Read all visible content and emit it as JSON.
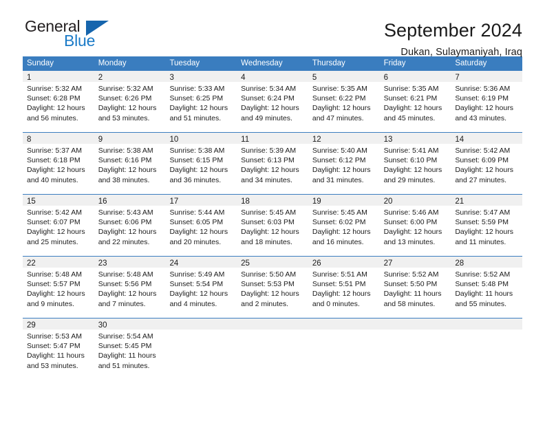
{
  "brand": {
    "line1": "General",
    "line2": "Blue",
    "flag_icon": "blue-triangle-flag",
    "colors": {
      "general": "#231f20",
      "blue": "#1a7ac7",
      "flag": "#1665ad"
    }
  },
  "header": {
    "title": "September 2024",
    "subtitle": "Dukan, Sulaymaniyah, Iraq"
  },
  "theme": {
    "header_blue": "#3a7dbf",
    "daynum_band": "#f0f0f0",
    "text": "#1a1a1a"
  },
  "weekdays": [
    "Sunday",
    "Monday",
    "Tuesday",
    "Wednesday",
    "Thursday",
    "Friday",
    "Saturday"
  ],
  "weeks": [
    [
      {
        "day": "1",
        "detail": "Sunrise: 5:32 AM\nSunset: 6:28 PM\nDaylight: 12 hours\nand 56 minutes."
      },
      {
        "day": "2",
        "detail": "Sunrise: 5:32 AM\nSunset: 6:26 PM\nDaylight: 12 hours\nand 53 minutes."
      },
      {
        "day": "3",
        "detail": "Sunrise: 5:33 AM\nSunset: 6:25 PM\nDaylight: 12 hours\nand 51 minutes."
      },
      {
        "day": "4",
        "detail": "Sunrise: 5:34 AM\nSunset: 6:24 PM\nDaylight: 12 hours\nand 49 minutes."
      },
      {
        "day": "5",
        "detail": "Sunrise: 5:35 AM\nSunset: 6:22 PM\nDaylight: 12 hours\nand 47 minutes."
      },
      {
        "day": "6",
        "detail": "Sunrise: 5:35 AM\nSunset: 6:21 PM\nDaylight: 12 hours\nand 45 minutes."
      },
      {
        "day": "7",
        "detail": "Sunrise: 5:36 AM\nSunset: 6:19 PM\nDaylight: 12 hours\nand 43 minutes."
      }
    ],
    [
      {
        "day": "8",
        "detail": "Sunrise: 5:37 AM\nSunset: 6:18 PM\nDaylight: 12 hours\nand 40 minutes."
      },
      {
        "day": "9",
        "detail": "Sunrise: 5:38 AM\nSunset: 6:16 PM\nDaylight: 12 hours\nand 38 minutes."
      },
      {
        "day": "10",
        "detail": "Sunrise: 5:38 AM\nSunset: 6:15 PM\nDaylight: 12 hours\nand 36 minutes."
      },
      {
        "day": "11",
        "detail": "Sunrise: 5:39 AM\nSunset: 6:13 PM\nDaylight: 12 hours\nand 34 minutes."
      },
      {
        "day": "12",
        "detail": "Sunrise: 5:40 AM\nSunset: 6:12 PM\nDaylight: 12 hours\nand 31 minutes."
      },
      {
        "day": "13",
        "detail": "Sunrise: 5:41 AM\nSunset: 6:10 PM\nDaylight: 12 hours\nand 29 minutes."
      },
      {
        "day": "14",
        "detail": "Sunrise: 5:42 AM\nSunset: 6:09 PM\nDaylight: 12 hours\nand 27 minutes."
      }
    ],
    [
      {
        "day": "15",
        "detail": "Sunrise: 5:42 AM\nSunset: 6:07 PM\nDaylight: 12 hours\nand 25 minutes."
      },
      {
        "day": "16",
        "detail": "Sunrise: 5:43 AM\nSunset: 6:06 PM\nDaylight: 12 hours\nand 22 minutes."
      },
      {
        "day": "17",
        "detail": "Sunrise: 5:44 AM\nSunset: 6:05 PM\nDaylight: 12 hours\nand 20 minutes."
      },
      {
        "day": "18",
        "detail": "Sunrise: 5:45 AM\nSunset: 6:03 PM\nDaylight: 12 hours\nand 18 minutes."
      },
      {
        "day": "19",
        "detail": "Sunrise: 5:45 AM\nSunset: 6:02 PM\nDaylight: 12 hours\nand 16 minutes."
      },
      {
        "day": "20",
        "detail": "Sunrise: 5:46 AM\nSunset: 6:00 PM\nDaylight: 12 hours\nand 13 minutes."
      },
      {
        "day": "21",
        "detail": "Sunrise: 5:47 AM\nSunset: 5:59 PM\nDaylight: 12 hours\nand 11 minutes."
      }
    ],
    [
      {
        "day": "22",
        "detail": "Sunrise: 5:48 AM\nSunset: 5:57 PM\nDaylight: 12 hours\nand 9 minutes."
      },
      {
        "day": "23",
        "detail": "Sunrise: 5:48 AM\nSunset: 5:56 PM\nDaylight: 12 hours\nand 7 minutes."
      },
      {
        "day": "24",
        "detail": "Sunrise: 5:49 AM\nSunset: 5:54 PM\nDaylight: 12 hours\nand 4 minutes."
      },
      {
        "day": "25",
        "detail": "Sunrise: 5:50 AM\nSunset: 5:53 PM\nDaylight: 12 hours\nand 2 minutes."
      },
      {
        "day": "26",
        "detail": "Sunrise: 5:51 AM\nSunset: 5:51 PM\nDaylight: 12 hours\nand 0 minutes."
      },
      {
        "day": "27",
        "detail": "Sunrise: 5:52 AM\nSunset: 5:50 PM\nDaylight: 11 hours\nand 58 minutes."
      },
      {
        "day": "28",
        "detail": "Sunrise: 5:52 AM\nSunset: 5:48 PM\nDaylight: 11 hours\nand 55 minutes."
      }
    ],
    [
      {
        "day": "29",
        "detail": "Sunrise: 5:53 AM\nSunset: 5:47 PM\nDaylight: 11 hours\nand 53 minutes."
      },
      {
        "day": "30",
        "detail": "Sunrise: 5:54 AM\nSunset: 5:45 PM\nDaylight: 11 hours\nand 51 minutes."
      },
      {
        "day": "",
        "detail": ""
      },
      {
        "day": "",
        "detail": ""
      },
      {
        "day": "",
        "detail": ""
      },
      {
        "day": "",
        "detail": ""
      },
      {
        "day": "",
        "detail": ""
      }
    ]
  ]
}
